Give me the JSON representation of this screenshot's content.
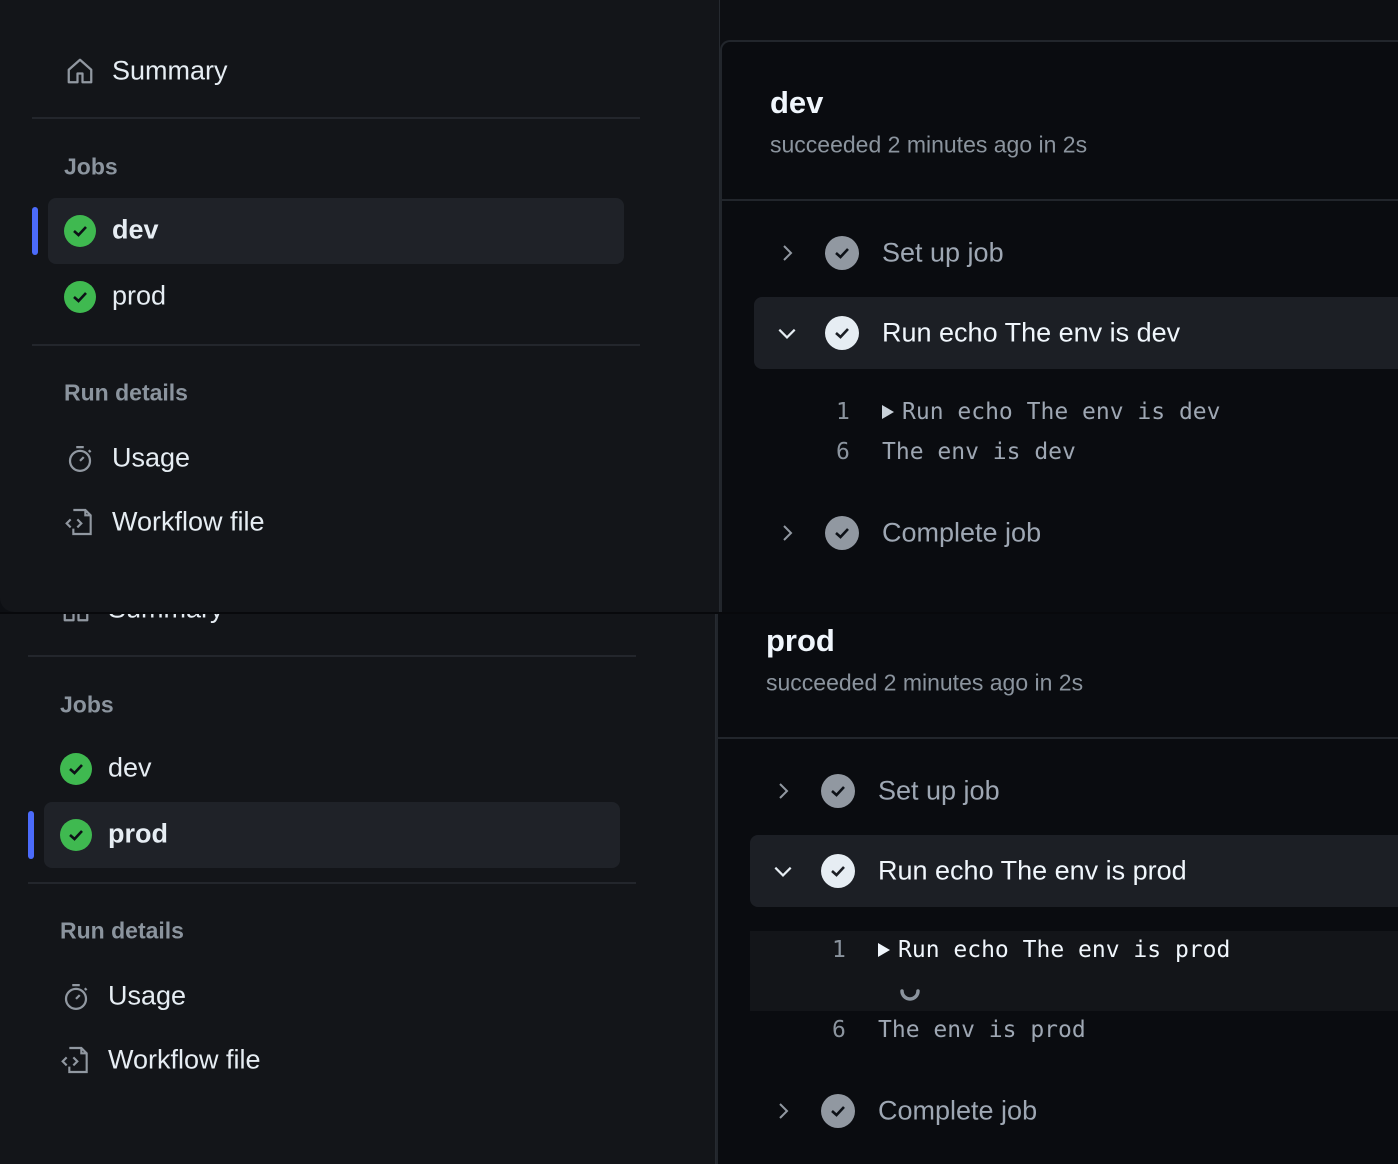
{
  "colors": {
    "success": "#3fb950",
    "accent": "#4b6bfb",
    "step_check": "#9198a1"
  },
  "top": {
    "sidebar": {
      "summary": "Summary",
      "jobs_heading": "Jobs",
      "jobs": [
        {
          "label": "dev",
          "status": "success",
          "selected": true
        },
        {
          "label": "prod",
          "status": "success",
          "selected": false
        }
      ],
      "run_details_heading": "Run details",
      "usage": "Usage",
      "workflow_file": "Workflow file"
    },
    "job": {
      "title": "dev",
      "subtitle": "succeeded 2 minutes ago in 2s",
      "steps": [
        {
          "label": "Set up job",
          "expanded": false
        },
        {
          "label": "Run echo The env is dev",
          "expanded": true
        },
        {
          "label": "Complete job",
          "expanded": false
        }
      ],
      "log": [
        {
          "num": "1",
          "text": "Run echo The env is dev",
          "collapsible": true
        },
        {
          "num": "6",
          "text": "The env is dev"
        }
      ]
    }
  },
  "bottom": {
    "sidebar": {
      "summary": "Summary",
      "jobs_heading": "Jobs",
      "jobs": [
        {
          "label": "dev",
          "status": "success",
          "selected": false
        },
        {
          "label": "prod",
          "status": "success",
          "selected": true
        }
      ],
      "run_details_heading": "Run details",
      "usage": "Usage",
      "workflow_file": "Workflow file"
    },
    "job": {
      "title": "prod",
      "subtitle": "succeeded 2 minutes ago in 2s",
      "steps": [
        {
          "label": "Set up job",
          "expanded": false
        },
        {
          "label": "Run echo The env is prod",
          "expanded": true
        },
        {
          "label": "Complete job",
          "expanded": false
        }
      ],
      "log": [
        {
          "num": "1",
          "text": "Run echo The env is prod",
          "collapsible": true,
          "loading": true
        },
        {
          "num": "6",
          "text": "The env is prod"
        }
      ]
    }
  }
}
